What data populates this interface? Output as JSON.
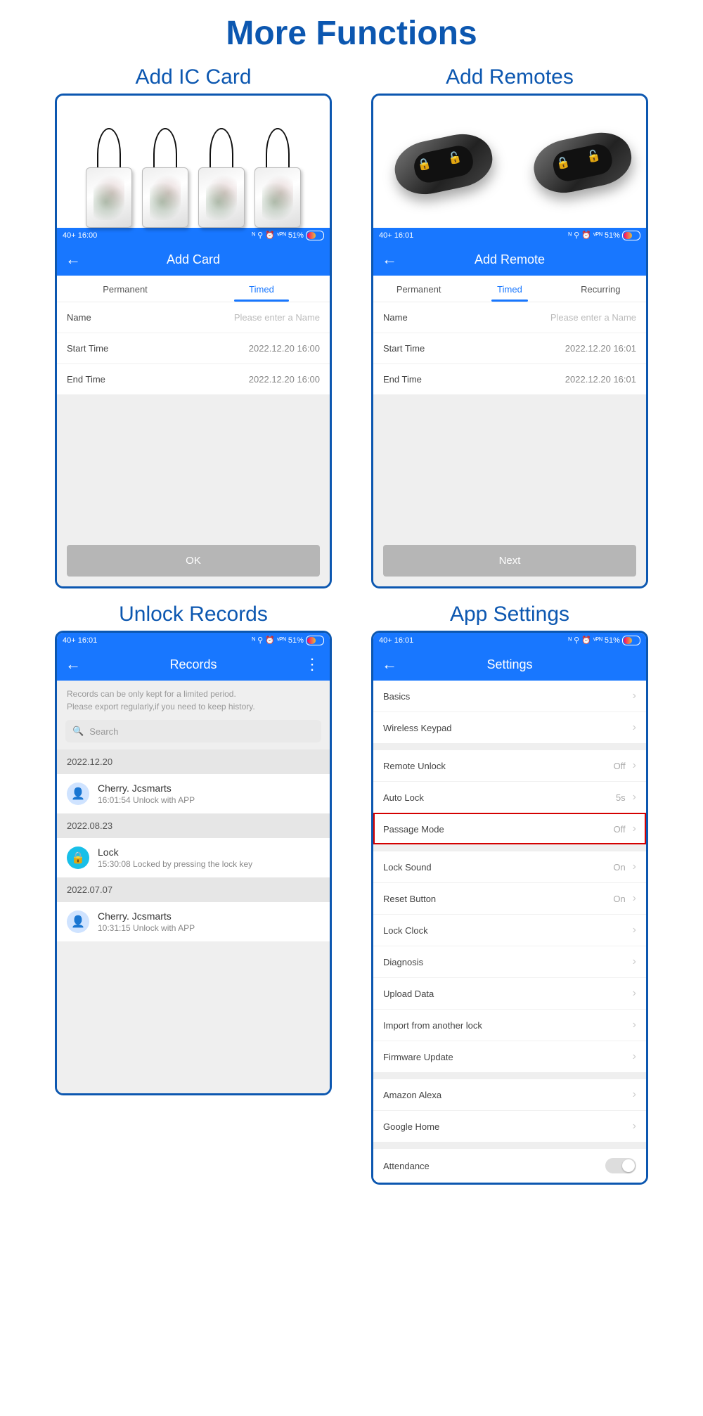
{
  "main_title": "More Functions",
  "cards": {
    "ic": {
      "heading": "Add IC Card",
      "status_left": "40+ 16:00",
      "status_right": "51%",
      "appbar": "Add Card",
      "tabs": [
        "Permanent",
        "Timed"
      ],
      "active_tab": 1,
      "name_label": "Name",
      "name_placeholder": "Please enter a Name",
      "start_label": "Start Time",
      "start_value": "2022.12.20 16:00",
      "end_label": "End Time",
      "end_value": "2022.12.20 16:00",
      "button": "OK"
    },
    "remote": {
      "heading": "Add Remotes",
      "status_left": "40+ 16:01",
      "status_right": "51%",
      "appbar": "Add Remote",
      "tabs": [
        "Permanent",
        "Timed",
        "Recurring"
      ],
      "active_tab": 1,
      "name_label": "Name",
      "name_placeholder": "Please enter a Name",
      "start_label": "Start Time",
      "start_value": "2022.12.20 16:01",
      "end_label": "End Time",
      "end_value": "2022.12.20 16:01",
      "button": "Next"
    },
    "records": {
      "heading": "Unlock Records",
      "status_left": "40+ 16:01",
      "status_right": "51%",
      "appbar": "Records",
      "hint1": "Records can be only kept for a limited period.",
      "hint2": "Please export regularly,if you need to keep history.",
      "search_placeholder": "Search",
      "entries": [
        {
          "date": "2022.12.20",
          "icon": "person",
          "name": "Cherry. Jcsmarts",
          "detail": "16:01:54 Unlock with APP"
        },
        {
          "date": "2022.08.23",
          "icon": "lock",
          "name": "Lock",
          "detail": "15:30:08 Locked by pressing the lock key"
        },
        {
          "date": "2022.07.07",
          "icon": "person",
          "name": "Cherry. Jcsmarts",
          "detail": "10:31:15 Unlock with APP"
        }
      ]
    },
    "settings": {
      "heading": "App Settings",
      "status_left": "40+ 16:01",
      "status_right": "51%",
      "appbar": "Settings",
      "groups": [
        [
          {
            "label": "Basics",
            "value": ""
          },
          {
            "label": "Wireless Keypad",
            "value": ""
          }
        ],
        [
          {
            "label": "Remote Unlock",
            "value": "Off"
          },
          {
            "label": "Auto Lock",
            "value": "5s"
          },
          {
            "label": "Passage Mode",
            "value": "Off",
            "highlight": true
          }
        ],
        [
          {
            "label": "Lock Sound",
            "value": "On"
          },
          {
            "label": "Reset Button",
            "value": "On"
          },
          {
            "label": "Lock Clock",
            "value": ""
          },
          {
            "label": "Diagnosis",
            "value": ""
          },
          {
            "label": "Upload Data",
            "value": ""
          },
          {
            "label": "Import from another lock",
            "value": ""
          },
          {
            "label": "Firmware Update",
            "value": ""
          }
        ],
        [
          {
            "label": "Amazon Alexa",
            "value": ""
          },
          {
            "label": "Google Home",
            "value": ""
          }
        ],
        [
          {
            "label": "Attendance",
            "value": "",
            "toggle": true
          }
        ]
      ]
    }
  }
}
